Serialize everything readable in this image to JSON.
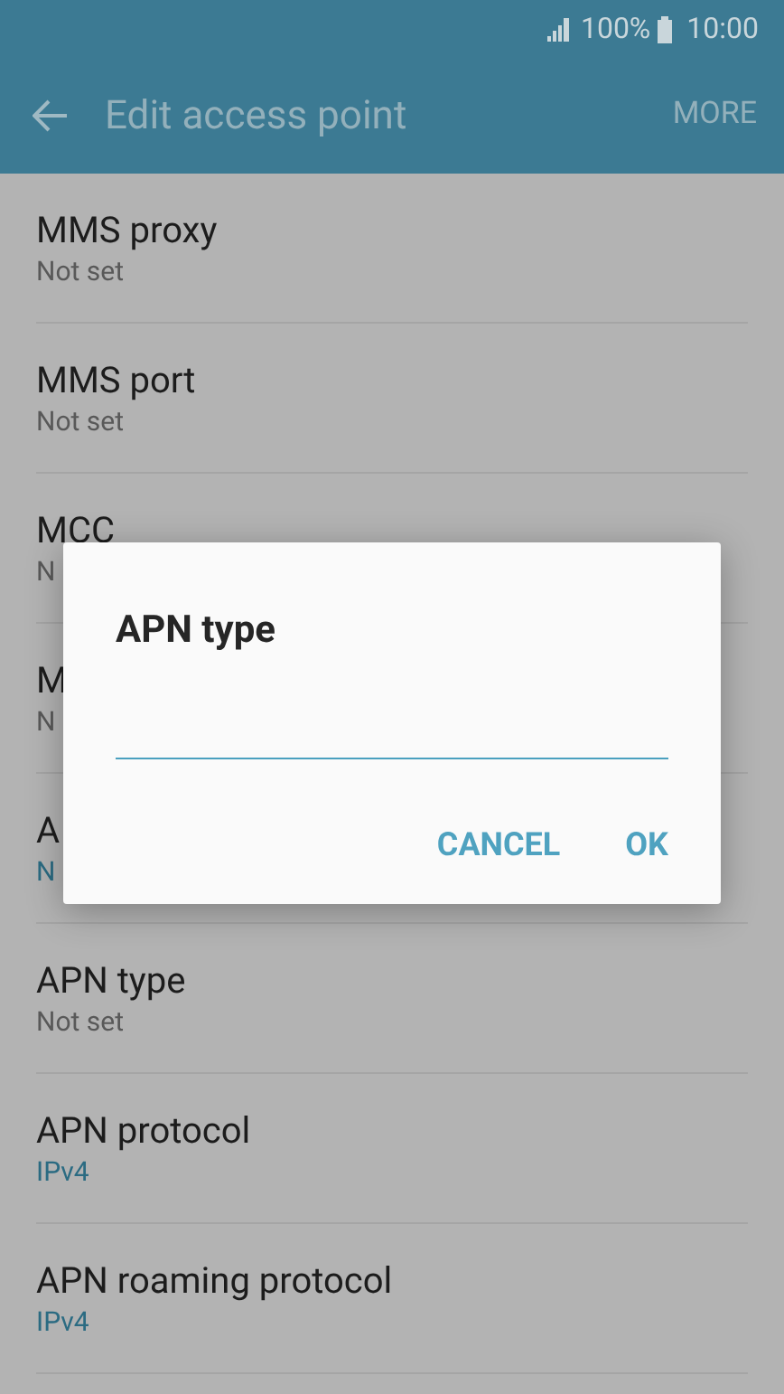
{
  "status_bar": {
    "battery_text": "100%",
    "time": "10:00"
  },
  "toolbar": {
    "title": "Edit access point",
    "more": "MORE"
  },
  "settings": [
    {
      "title": "MMS proxy",
      "value": "Not set",
      "accent": false
    },
    {
      "title": "MMS port",
      "value": "Not set",
      "accent": false
    },
    {
      "title": "MCC",
      "value": "N",
      "accent": false
    },
    {
      "title": "M",
      "value": "N",
      "accent": false
    },
    {
      "title": "A",
      "value": "N",
      "accent": true
    },
    {
      "title": "APN type",
      "value": "Not set",
      "accent": false
    },
    {
      "title": "APN protocol",
      "value": "IPv4",
      "accent": true
    },
    {
      "title": "APN roaming protocol",
      "value": "IPv4",
      "accent": true
    }
  ],
  "dialog": {
    "title": "APN type",
    "buttons": [
      "CANCEL",
      "OK"
    ]
  }
}
